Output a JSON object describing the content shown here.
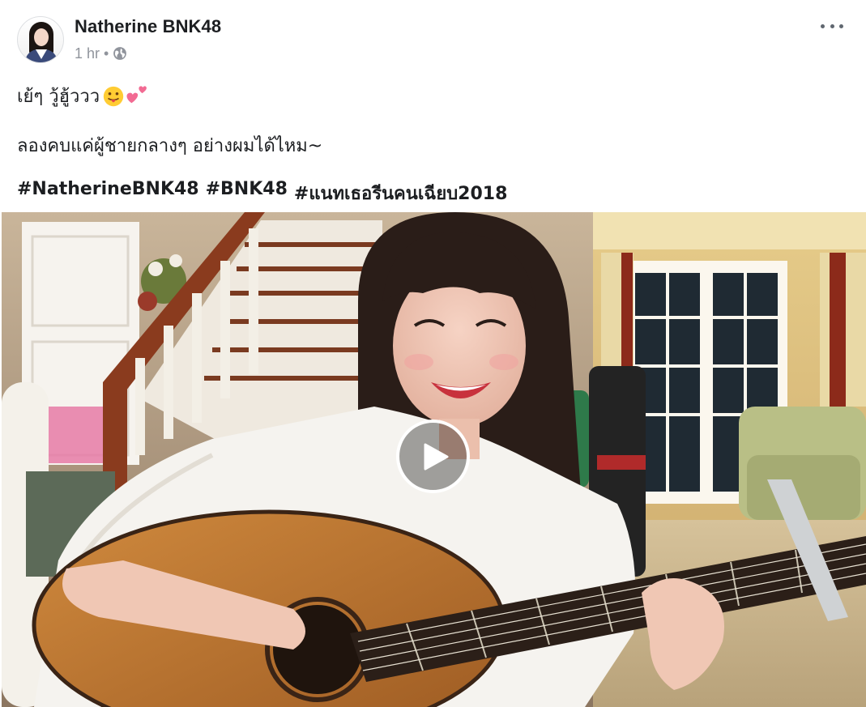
{
  "post": {
    "author": "Natherine BNK48",
    "time": "1 hr",
    "separator": "•",
    "privacy_icon": "globe-icon",
    "more_icon": "more-options-icon",
    "text_line1": "เย้ๆ วู้ฮู้ววว",
    "text_line1_emojis": [
      "tongue-face-emoji",
      "two-hearts-emoji"
    ],
    "text_line2": "ลองคบแค่ผู้ชายกลางๆ อย่างผมได้ไหม~",
    "hashtags": [
      "#NatherineBNK48",
      "#BNK48",
      "#แนทเธอรีนคนเฉียบ2018"
    ]
  },
  "video": {
    "thumbnail": "girl-playing-acoustic-guitar-thumbnail",
    "play_icon": "play-icon"
  },
  "colors": {
    "text": "#1c1e21",
    "meta": "#90949c",
    "icon": "#606770",
    "play_ring": "#ffffff"
  }
}
